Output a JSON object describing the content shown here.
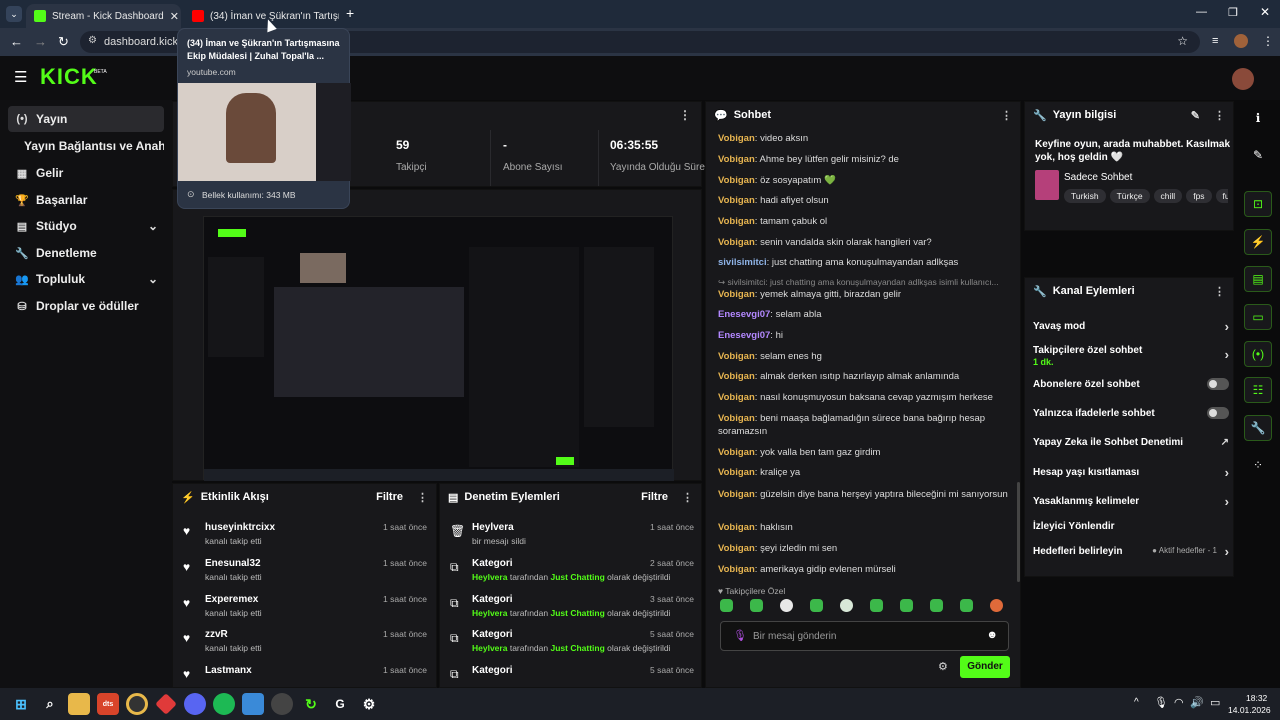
{
  "browser": {
    "tabs": [
      {
        "label": "Stream - Kick Dashboard",
        "active": true
      },
      {
        "label": "(34) İman ve Şükran'ın Tartışma",
        "active": false
      }
    ],
    "url": "dashboard.kick.co",
    "tooltip": {
      "title": "(34) İman ve Şükran'ın Tartışmasına Ekip Müdalesi | Zuhal Topal'la ...",
      "domain": "youtube.com",
      "memory": "Bellek kullanımı: 343 MB"
    }
  },
  "topnav": {
    "logo": "KICK",
    "logo_badge": "BETA"
  },
  "sidebar": {
    "items": [
      {
        "label": "Yayın",
        "icon": "broadcast-icon"
      },
      {
        "label": "Yayın Bağlantısı ve Anahtarı",
        "icon": ""
      },
      {
        "label": "Gelir",
        "icon": "revenue-icon"
      },
      {
        "label": "Başarılar",
        "icon": "trophy-icon"
      },
      {
        "label": "Stüdyo",
        "icon": "studio-icon"
      },
      {
        "label": "Denetleme",
        "icon": "wrench-icon"
      },
      {
        "label": "Topluluk",
        "icon": "community-icon"
      },
      {
        "label": "Droplar ve ödüller",
        "icon": "drops-icon"
      }
    ]
  },
  "stats": [
    {
      "value": "59",
      "label": "Takipçi"
    },
    {
      "value": "-",
      "label": "Abone Sayısı"
    },
    {
      "value": "06:35:55",
      "label": "Yayında Olduğu Süre"
    }
  ],
  "chat": {
    "title": "Sohbet",
    "messages": [
      {
        "user": "Vobigan",
        "text": "video aksın"
      },
      {
        "user": "Vobigan",
        "text": "Ahme bey lütfen gelir misiniz? de"
      },
      {
        "user": "Vobigan",
        "text": "öz sosyapatım 💚"
      },
      {
        "user": "Vobigan",
        "text": "hadi afiyet olsun"
      },
      {
        "user": "Vobigan",
        "text": "tamam çabuk ol"
      },
      {
        "user": "Vobigan",
        "text": "senin vandalda skin olarak hangileri var?"
      },
      {
        "user": "sivilsimitci",
        "text": "just chatting ama konuşulmayandan adlkşas"
      },
      {
        "user": "",
        "text": "↪ sivilsimitci: just chatting ama konuşulmayandan adlkşas isimli kullanıcı..."
      },
      {
        "user": "Vobigan",
        "text": "yemek almaya gitti, birazdan gelir"
      },
      {
        "user": "Enesevgi07",
        "text": "selam abla"
      },
      {
        "user": "Enesevgi07",
        "text": "hi"
      },
      {
        "user": "Vobigan",
        "text": "selam enes hg"
      },
      {
        "user": "Vobigan",
        "text": "almak derken ısıtıp hazırlayıp almak anlamında"
      },
      {
        "user": "Vobigan",
        "text": "nasıl konuşmuyosun baksana cevap yazmışım herkese"
      },
      {
        "user": "Vobigan",
        "text": "beni maaşa bağlamadığın sürece bana bağırıp hesap soramazsın"
      },
      {
        "user": "Vobigan",
        "text": "yok valla ben tam gaz girdim"
      },
      {
        "user": "Vobigan",
        "text": "kraliçe ya"
      },
      {
        "user": "Vobigan",
        "text": "güzelsin diye bana herşeyi yaptıra bileceğini mi sanıyorsun"
      },
      {
        "user": "Vobigan",
        "text": "haklısın"
      },
      {
        "user": "Vobigan",
        "text": "şeyi izledin mi sen"
      },
      {
        "user": "Vobigan",
        "text": "amerikaya gidip evlenen mürseli"
      }
    ],
    "followers_label": "♥ Takipçilere Özel",
    "input_placeholder": "Bir mesaj gönderin",
    "send_label": "Gönder"
  },
  "stream_info": {
    "title": "Yayın bilgisi",
    "description": "Keyfine oyun, arada muhabbet. Kasılmak yok, hoş geldin 🤍",
    "category": "Sadece Sohbet",
    "tags": [
      "Turkish",
      "Türkçe",
      "chill",
      "fps",
      "fu"
    ]
  },
  "channel_actions": {
    "title": "Kanal Eylemleri",
    "items": [
      {
        "label": "Yavaş mod",
        "control": "arrow",
        "sub": ""
      },
      {
        "label": "Takipçilere özel sohbet",
        "control": "arrow",
        "sub": "1 dk."
      },
      {
        "label": "Abonelere özel sohbet",
        "control": "toggle",
        "sub": ""
      },
      {
        "label": "Yalnızca ifadelerle sohbet",
        "control": "toggle",
        "sub": ""
      },
      {
        "label": "Yapay Zeka ile Sohbet Denetimi",
        "control": "external",
        "sub": ""
      },
      {
        "label": "Hesap yaşı kısıtlaması",
        "control": "arrow",
        "sub": ""
      },
      {
        "label": "Yasaklanmış kelimeler",
        "control": "arrow",
        "sub": ""
      },
      {
        "label": "İzleyici Yönlendir",
        "control": "none",
        "sub": ""
      },
      {
        "label": "Hedefleri belirleyin",
        "control": "arrow",
        "sub": "● Aktif hedefler - 1"
      }
    ]
  },
  "activity": {
    "title": "Etkinlik Akışı",
    "filter": "Filtre",
    "items": [
      {
        "name": "huseyinktrcixx",
        "sub": "kanalı takip etti",
        "time": "1 saat önce"
      },
      {
        "name": "Enesunal32",
        "sub": "kanalı takip etti",
        "time": "1 saat önce"
      },
      {
        "name": "Experemex",
        "sub": "kanalı takip etti",
        "time": "1 saat önce"
      },
      {
        "name": "zzvR",
        "sub": "kanalı takip etti",
        "time": "1 saat önce"
      },
      {
        "name": "Lastmanx",
        "sub": "",
        "time": "1 saat önce"
      }
    ]
  },
  "moderation": {
    "title": "Denetim Eylemleri",
    "filter": "Filtre",
    "items": [
      {
        "name": "Heylvera",
        "sub1": "bir mesajı sildi",
        "sub2": "",
        "sub3": "",
        "time": "1 saat önce"
      },
      {
        "name": "Kategori",
        "sub1": "Heylvera",
        "sub2": "tarafından",
        "sub3": "Just Chatting",
        "sub4": "olarak değiştirildi",
        "time": "2 saat önce"
      },
      {
        "name": "Kategori",
        "sub1": "Heylvera",
        "sub2": "tarafından",
        "sub3": "Just Chatting",
        "sub4": "olarak değiştirildi",
        "time": "3 saat önce"
      },
      {
        "name": "Kategori",
        "sub1": "Heylvera",
        "sub2": "tarafından",
        "sub3": "Just Chatting",
        "sub4": "olarak değiştirildi",
        "time": "5 saat önce"
      },
      {
        "name": "Kategori",
        "sub1": "",
        "sub2": "",
        "sub3": "",
        "sub4": "",
        "time": "5 saat önce"
      }
    ]
  },
  "taskbar": {
    "time": "18:32",
    "date": "14.01.2026"
  }
}
